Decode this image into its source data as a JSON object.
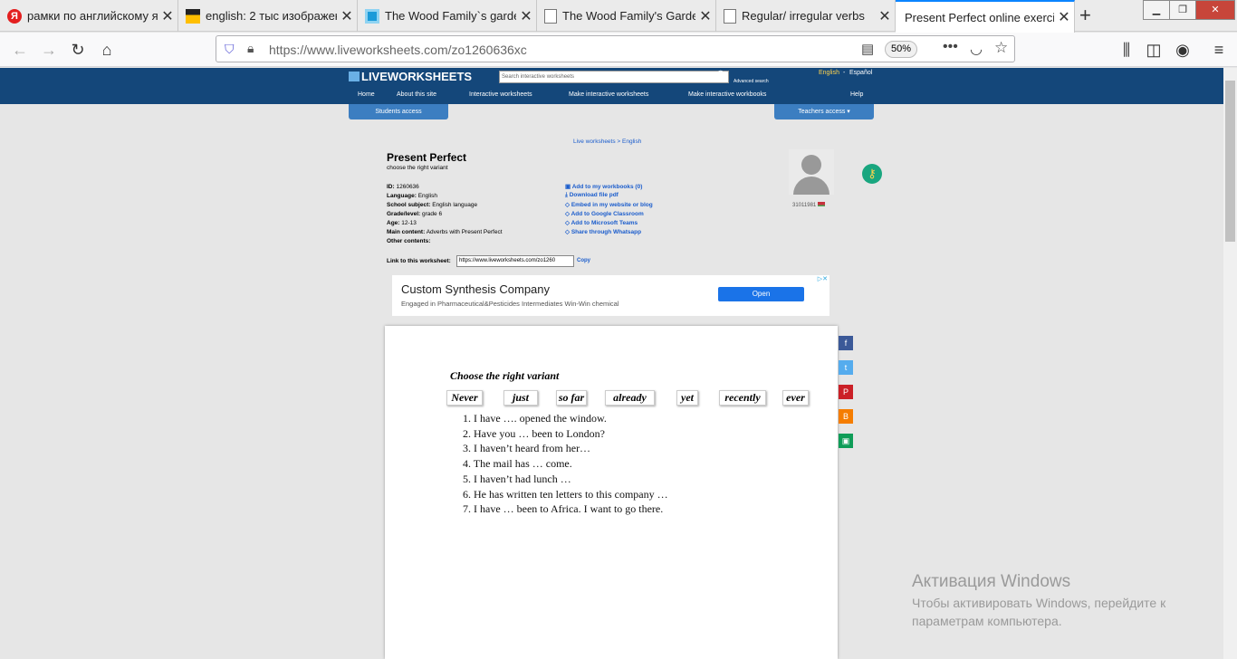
{
  "tabs": [
    {
      "title": "рамки по английскому я",
      "icon": "yandex-icon",
      "color": "#e31f1f"
    },
    {
      "title": "english: 2 тыс изображен",
      "icon": "image-search-icon",
      "color": "#ffbf00"
    },
    {
      "title": "The Wood Family`s garden",
      "icon": "liveworksheets-icon",
      "color": "#1b9bd9"
    },
    {
      "title": "The Wood Family's Garde",
      "icon": "document-icon",
      "color": "#888888"
    },
    {
      "title": "Regular/ irregular verbs",
      "icon": "document-icon",
      "color": "#888888"
    },
    {
      "title": "Present Perfect online exercise",
      "icon": "",
      "color": ""
    }
  ],
  "url": "https://www.liveworksheets.com/zo1260636xc",
  "url_host": "liveworksheets.com",
  "zoom": "50%",
  "site": {
    "logo": "LIVEWORKSHEETS",
    "search_placeholder": "Search interactive worksheets",
    "advanced": "Advanced search",
    "lang_en": "English",
    "lang_sep": "-",
    "lang_es": "Español",
    "nav": [
      "Home",
      "About this site",
      "Interactive worksheets",
      "Make interactive worksheets",
      "Make interactive workbooks",
      "Help"
    ],
    "students": "Students access",
    "teachers": "Teachers access ▾",
    "breadcrumb": "Live worksheets > English"
  },
  "worksheet": {
    "title": "Present Perfect",
    "subtitle": "choose the right variant",
    "meta": [
      {
        "k": "ID:",
        "v": "1260636"
      },
      {
        "k": "Language:",
        "v": "English"
      },
      {
        "k": "School subject:",
        "v": "English language"
      },
      {
        "k": "Grade/level:",
        "v": "grade 6"
      },
      {
        "k": "Age:",
        "v": "12-13"
      },
      {
        "k": "Main content:",
        "v": "Adverbs with Present Perfect"
      },
      {
        "k": "Other contents:",
        "v": ""
      }
    ],
    "actions": [
      "Add to my workbooks (0)",
      "Download file pdf",
      "Embed in my website or blog",
      "Add to Google Classroom",
      "Add to Microsoft Teams",
      "Share through Whatsapp"
    ],
    "author": "31011981",
    "link_label": "Link to this worksheet:",
    "link_value": "https://www.liveworksheets.com/zo1260",
    "copy": "Copy"
  },
  "ad": {
    "title": "Custom Synthesis Company",
    "text": "Engaged in Pharmaceutical&Pesticides Intermediates Win-Win chemical",
    "button": "Open"
  },
  "exercise": {
    "heading": "Choose the right variant",
    "words": [
      "Never",
      "just",
      "so far",
      "already",
      "yet",
      "recently",
      "ever"
    ],
    "items": [
      "1.  I have   …. opened the window.",
      "2.  Have you … been to London?",
      "3.  I haven’t heard from her…",
      "4.  The mail has … come.",
      "5.  I haven’t had lunch …",
      "6.  He has written ten letters to this company …",
      "7.  I have … been to Africa. I want to go there."
    ]
  },
  "watermark": {
    "title": "Активация Windows",
    "line1": "Чтобы активировать Windows, перейдите к",
    "line2": "параметрам компьютера."
  }
}
